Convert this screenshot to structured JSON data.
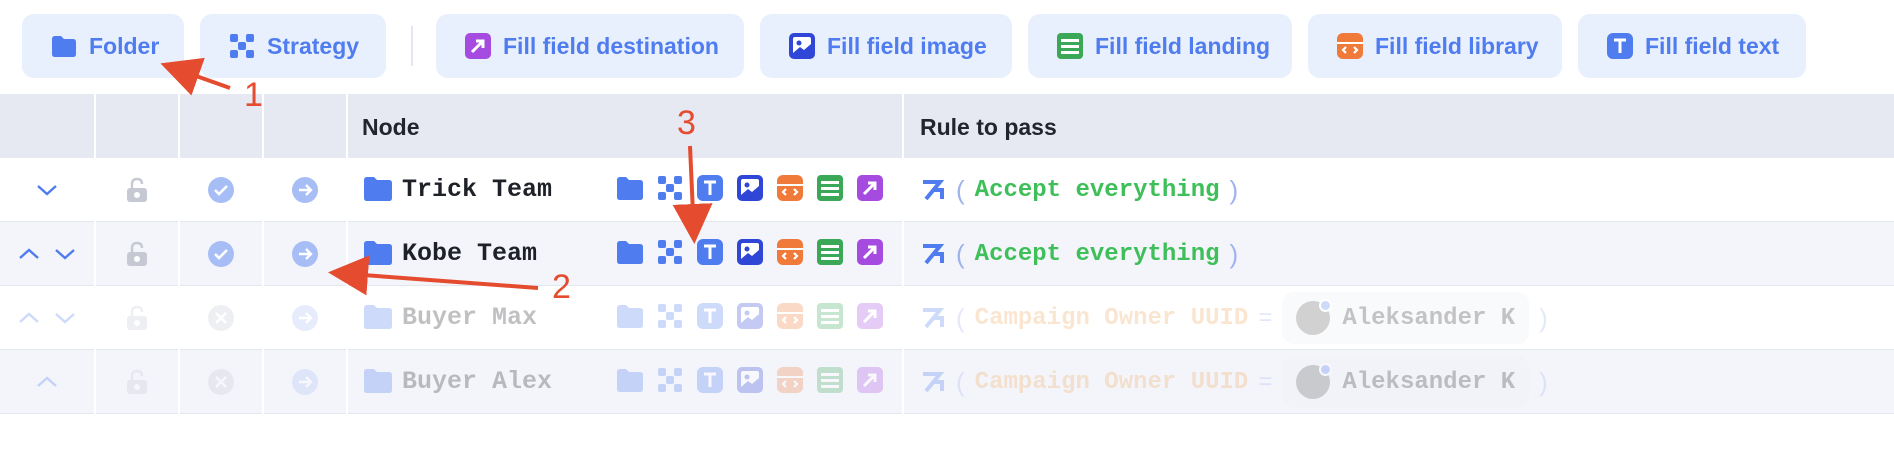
{
  "toolbar": {
    "buttons": [
      {
        "label": "Folder",
        "icon": "folder-icon"
      },
      {
        "label": "Strategy",
        "icon": "strategy-icon"
      },
      {
        "label": "Fill field destination",
        "icon": "destination-icon"
      },
      {
        "label": "Fill field image",
        "icon": "image-icon"
      },
      {
        "label": "Fill field landing",
        "icon": "landing-icon"
      },
      {
        "label": "Fill field library",
        "icon": "library-icon"
      },
      {
        "label": "Fill field text",
        "icon": "text-icon"
      }
    ]
  },
  "table": {
    "headers": {
      "node": "Node",
      "rule": "Rule to pass"
    },
    "rows": [
      {
        "name": "Trick Team",
        "rule_kind": "accept",
        "rule_text": "Accept everything",
        "enabled": true,
        "arrows": [
          "down"
        ]
      },
      {
        "name": "Kobe Team",
        "rule_kind": "accept",
        "rule_text": "Accept everything",
        "enabled": true,
        "arrows": [
          "up",
          "down"
        ]
      },
      {
        "name": "Buyer Max",
        "rule_kind": "field",
        "rule_field": "Campaign Owner UUID",
        "rule_op": "=",
        "rule_value": "Aleksander K",
        "enabled": false,
        "arrows": [
          "up",
          "down"
        ]
      },
      {
        "name": "Buyer Alex",
        "rule_kind": "field",
        "rule_field": "Campaign Owner UUID",
        "rule_op": "=",
        "rule_value": "Aleksander K",
        "enabled": false,
        "arrows": [
          "up"
        ]
      }
    ],
    "paren_open": "(",
    "paren_close": ")"
  },
  "annotations": [
    "1",
    "2",
    "3"
  ],
  "colors": {
    "accent": "#4f7cee",
    "button_bg": "#e8effd",
    "header_bg": "#e6e8f2",
    "accept_green": "#3fbf5a",
    "field_orange": "#f0a85a",
    "annotation_red": "#e54b2e",
    "purple": "#a64be0",
    "green": "#3aa856",
    "orange": "#f07a3a"
  }
}
